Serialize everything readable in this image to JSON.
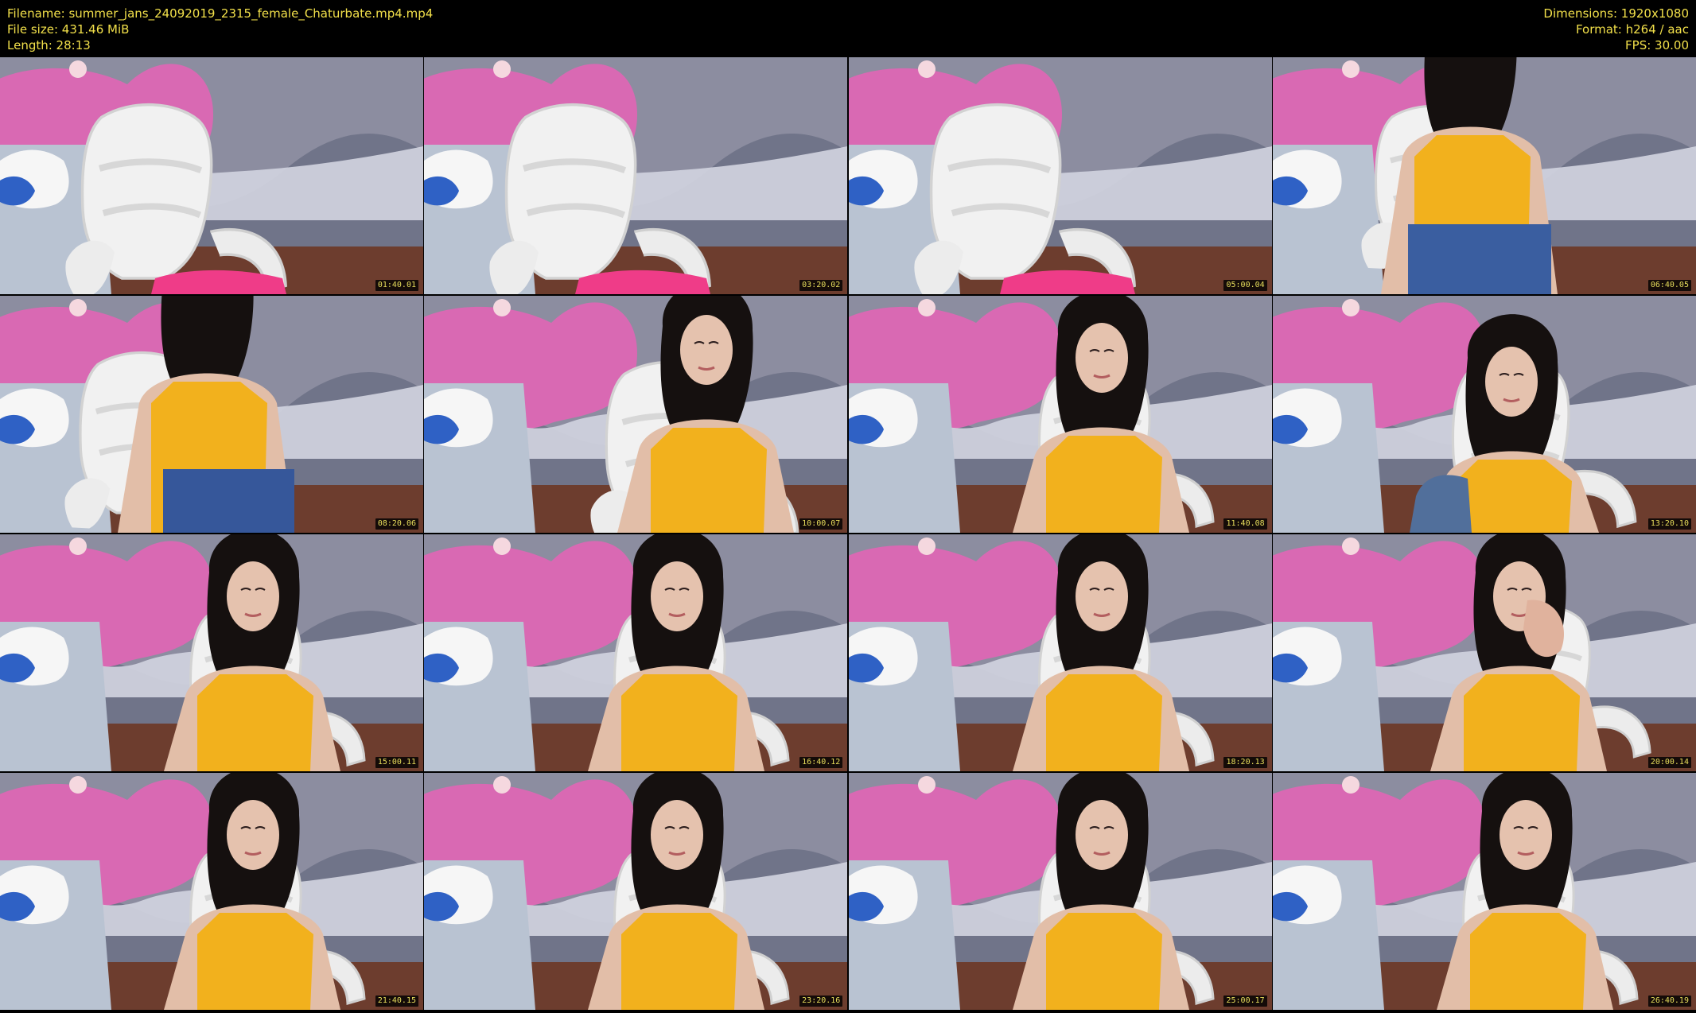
{
  "header": {
    "filename": "Filename: summer_jans_24092019_2315_female_Chaturbate.mp4.mp4",
    "file_size": "File size: 431.46 MiB",
    "length": "Length: 28:13",
    "dimensions": "Dimensions: 1920x1080",
    "format": "Format: h264 / aac",
    "fps": "FPS: 30.00"
  },
  "thumbnails": [
    {
      "timestamp": "01:40.01",
      "scene": "empty-chair"
    },
    {
      "timestamp": "03:20.02",
      "scene": "empty-chair"
    },
    {
      "timestamp": "05:00.04",
      "scene": "empty-chair"
    },
    {
      "timestamp": "06:40.05",
      "scene": "close-torso"
    },
    {
      "timestamp": "08:20.06",
      "scene": "standing"
    },
    {
      "timestamp": "10:00.07",
      "scene": "side-profile"
    },
    {
      "timestamp": "11:40.08",
      "scene": "seated"
    },
    {
      "timestamp": "13:20.10",
      "scene": "looking-down"
    },
    {
      "timestamp": "15:00.11",
      "scene": "seated"
    },
    {
      "timestamp": "16:40.12",
      "scene": "seated"
    },
    {
      "timestamp": "18:20.13",
      "scene": "seated"
    },
    {
      "timestamp": "20:00.14",
      "scene": "hand-face"
    },
    {
      "timestamp": "21:40.15",
      "scene": "seated"
    },
    {
      "timestamp": "23:20.16",
      "scene": "seated"
    },
    {
      "timestamp": "25:00.17",
      "scene": "seated"
    },
    {
      "timestamp": "26:40.19",
      "scene": "seated"
    }
  ]
}
